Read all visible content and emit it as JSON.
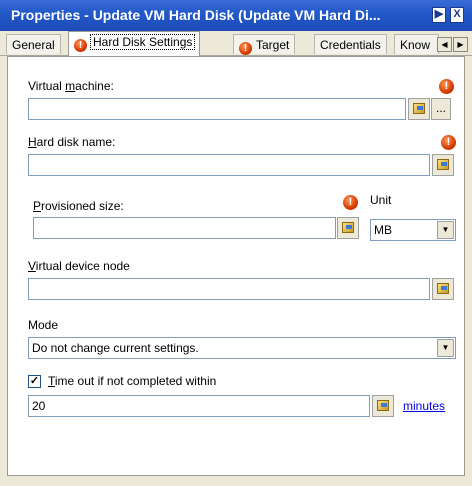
{
  "window": {
    "title": "Properties - Update VM Hard Disk (Update VM Hard Di...",
    "btn_next": "▶",
    "btn_close": "X"
  },
  "tabs": {
    "general": "General",
    "hard_disk_settings": "Hard Disk Settings",
    "target": "Target",
    "credentials": "Credentials",
    "know": "Know",
    "scroll_left": "◀",
    "scroll_right": "▶"
  },
  "form": {
    "vm_label_pre": "Virtual ",
    "vm_label_u": "m",
    "vm_label_post": "achine:",
    "vm_value": "",
    "ellipsis": "...",
    "hd_label_u": "H",
    "hd_label_post": "ard disk name:",
    "hd_value": "",
    "prov_label_u": "P",
    "prov_label_post": "rovisioned size:",
    "prov_value": "",
    "unit_label": "Unit",
    "unit_value": "MB",
    "vdn_label_u": "V",
    "vdn_label_post": "irtual device node",
    "vdn_value": "",
    "mode_label": "Mode",
    "mode_value": "Do not change current settings.",
    "timeout_checked": "✓",
    "timeout_label_u": "T",
    "timeout_label_post": "ime out if not completed within",
    "timeout_value": "20",
    "minutes_link": "minutes",
    "error_glyph": "!",
    "dropdown_glyph": "▼"
  }
}
